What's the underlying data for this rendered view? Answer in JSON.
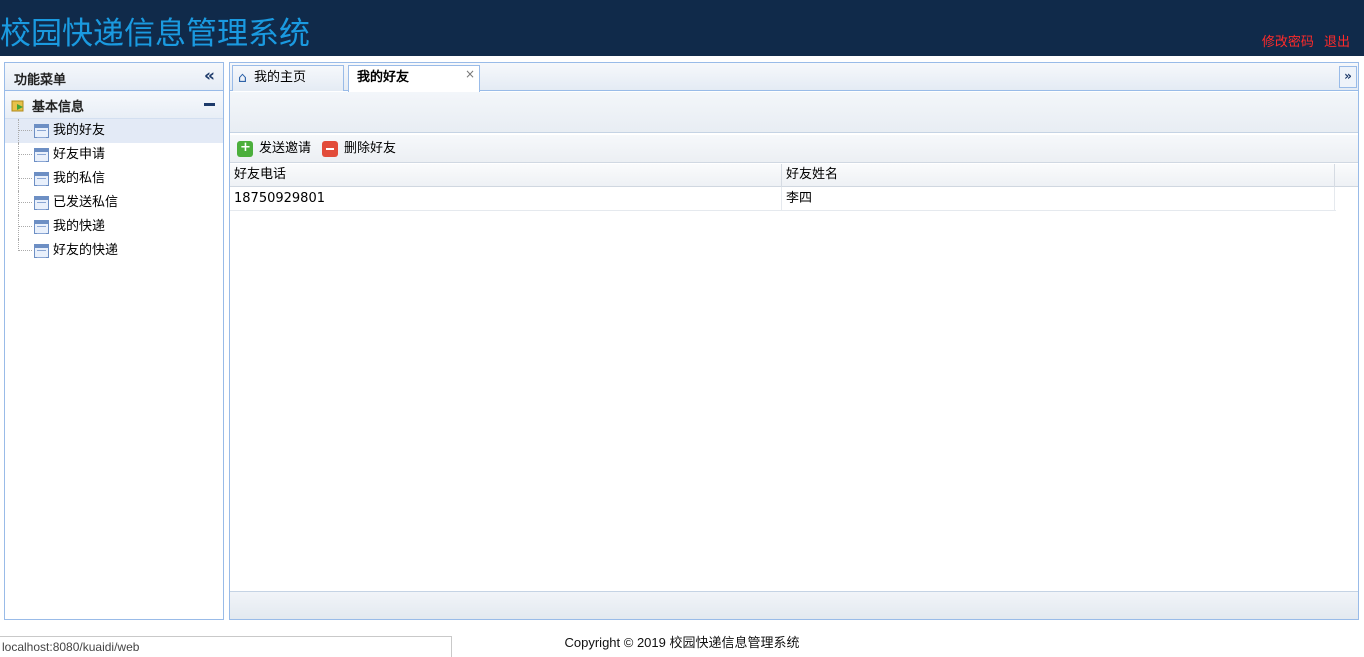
{
  "header": {
    "title": "校园快递信息管理系统",
    "change_password": "修改密码",
    "logout": "退出"
  },
  "sidebar": {
    "title": "功能菜单",
    "group": {
      "label": "基本信息",
      "items": [
        {
          "label": "我的好友",
          "active": true
        },
        {
          "label": "好友申请"
        },
        {
          "label": "我的私信"
        },
        {
          "label": "已发送私信"
        },
        {
          "label": "我的快递"
        },
        {
          "label": "好友的快递"
        }
      ]
    }
  },
  "tabs": {
    "home": "我的主页",
    "friends": "我的好友",
    "close_glyph": "×"
  },
  "toolbar": {
    "send_invite": "发送邀请",
    "delete_friend": "删除好友"
  },
  "grid": {
    "columns": [
      "好友电话",
      "好友姓名"
    ],
    "rows": [
      [
        "18750929801",
        "李四"
      ]
    ]
  },
  "footer": {
    "copyright": "Copyright © 2019 校园快递信息管理系统"
  },
  "statusbar": {
    "url": "localhost:8080/kuaidi/web"
  },
  "colors": {
    "header_bg": "#102a4a",
    "title": "#1a9ae0",
    "header_links": "#ff2a2a",
    "border": "#99bbe8"
  }
}
